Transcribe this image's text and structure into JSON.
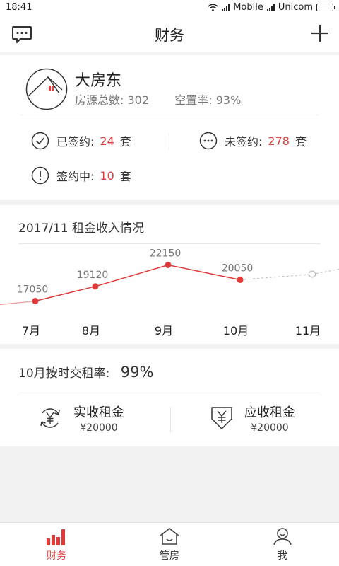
{
  "statusbar": {
    "time": "18:41",
    "carrier1": "Mobile",
    "carrier2": "Unicom"
  },
  "nav": {
    "title": "财务"
  },
  "owner": {
    "name": "大房东",
    "total_label": "房源总数:",
    "total_value": "302",
    "vacancy_label": "空置率:",
    "vacancy_value": "93%"
  },
  "signing": {
    "signed_label": "已签约:",
    "signed_value": "24",
    "unsigned_label": "未签约:",
    "unsigned_value": "278",
    "pending_label": "签约中:",
    "pending_value": "10",
    "unit": "套"
  },
  "chart_data": {
    "type": "line",
    "title": "2017/11  租金收入情况",
    "categories": [
      "7月",
      "8月",
      "9月",
      "10月",
      "11月"
    ],
    "series": [
      {
        "values": [
          17050,
          19120,
          22150,
          20050,
          null
        ]
      }
    ],
    "data_labels": [
      "17050",
      "19120",
      "22150",
      "20050"
    ],
    "ylim": [
      14000,
      24000
    ],
    "grid": false,
    "colors": {
      "line": "#e03a3a",
      "future": "#bbbbbb"
    }
  },
  "rent": {
    "rate_label": "10月按时交租率:",
    "rate_value": "99%",
    "actual_label": "实收租金",
    "actual_value": "¥20000",
    "due_label": "应收租金",
    "due_value": "¥20000"
  },
  "tabs": [
    {
      "label": "财务",
      "icon": "bar-chart-icon",
      "active": true
    },
    {
      "label": "管房",
      "icon": "house-icon",
      "active": false
    },
    {
      "label": "我",
      "icon": "person-icon",
      "active": false
    }
  ],
  "colors": {
    "accent": "#e03a3a",
    "text": "#333333",
    "muted": "#777777",
    "background": "#f2f2f2"
  }
}
